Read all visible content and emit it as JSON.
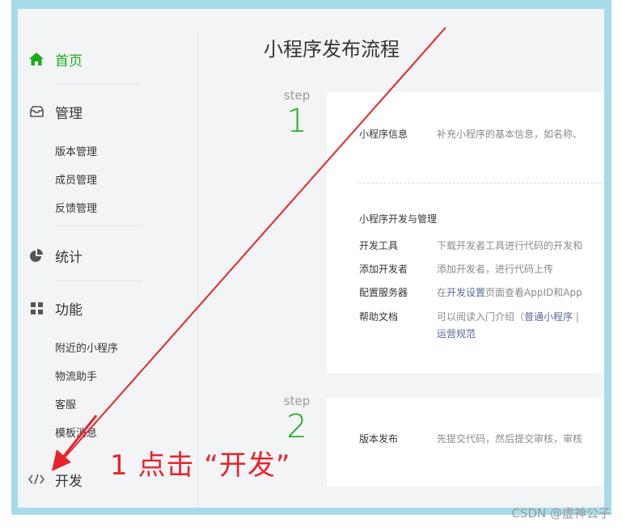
{
  "sidebar": {
    "home_label": "首页",
    "manage_label": "管理",
    "manage_items": [
      "版本管理",
      "成员管理",
      "反馈管理"
    ],
    "stats_label": "统计",
    "features_label": "功能",
    "feature_items": [
      "附近的小程序",
      "物流助手",
      "客服",
      "模板消息"
    ],
    "develop_label": "开发",
    "active_color": "#1aad19"
  },
  "main": {
    "title": "小程序发布流程",
    "steps": [
      {
        "word": "step",
        "number": "1"
      },
      {
        "word": "step",
        "number": "2"
      }
    ],
    "card1": {
      "info_key": "小程序信息",
      "info_val": "补充小程序的基本信息，如名称、",
      "section_title": "小程序开发与管理",
      "rows": [
        {
          "k": "开发工具",
          "v": "下载开发者工具进行代码的开发和"
        },
        {
          "k": "添加开发者",
          "v": "添加开发者，进行代码上传"
        },
        {
          "k": "配置服务器",
          "v_pre": "在",
          "v_link": "开发设置",
          "v_post": "页面查看AppID和App"
        },
        {
          "k": "帮助文档",
          "v_pre": "可以阅读入门介绍（",
          "v_link": "普通小程序",
          "v_post": " | ",
          "v_line2": "运营规范"
        }
      ]
    },
    "card2": {
      "k": "版本发布",
      "v": "先提交代码，然后提交审核，审核"
    }
  },
  "annotation": {
    "text": "1 点击 “开发”",
    "color": "#e8242b"
  },
  "watermark": "CSDN @虚神公子"
}
